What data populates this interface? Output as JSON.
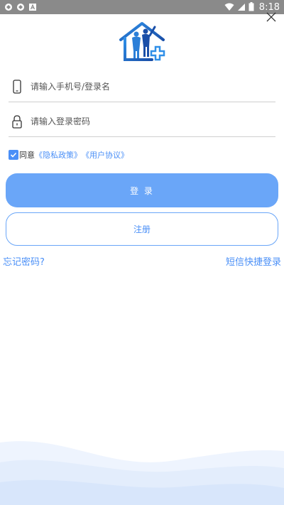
{
  "status_bar": {
    "time": "8:18",
    "icons": [
      "sync-icon",
      "sync-icon",
      "font-icon",
      "wifi-icon",
      "signal-icon",
      "battery-icon"
    ]
  },
  "header": {
    "close_icon": "close-icon",
    "logo_icon": "house-family-medical-logo"
  },
  "form": {
    "phone_placeholder": "请输入手机号/登录名",
    "phone_value": "",
    "password_placeholder": "请输入登录密码",
    "password_value": "",
    "agree_label": "同意",
    "privacy_link": "《隐私政策》",
    "terms_link": "《用户协议》",
    "agreed": true
  },
  "actions": {
    "login_label": "登 录",
    "register_label": "注册",
    "forgot_label": "忘记密码?",
    "sms_login_label": "短信快捷登录"
  },
  "colors": {
    "accent": "#4a8ff7",
    "login_button": "#6aa6f8",
    "status_bar": "#8a8a8a"
  }
}
